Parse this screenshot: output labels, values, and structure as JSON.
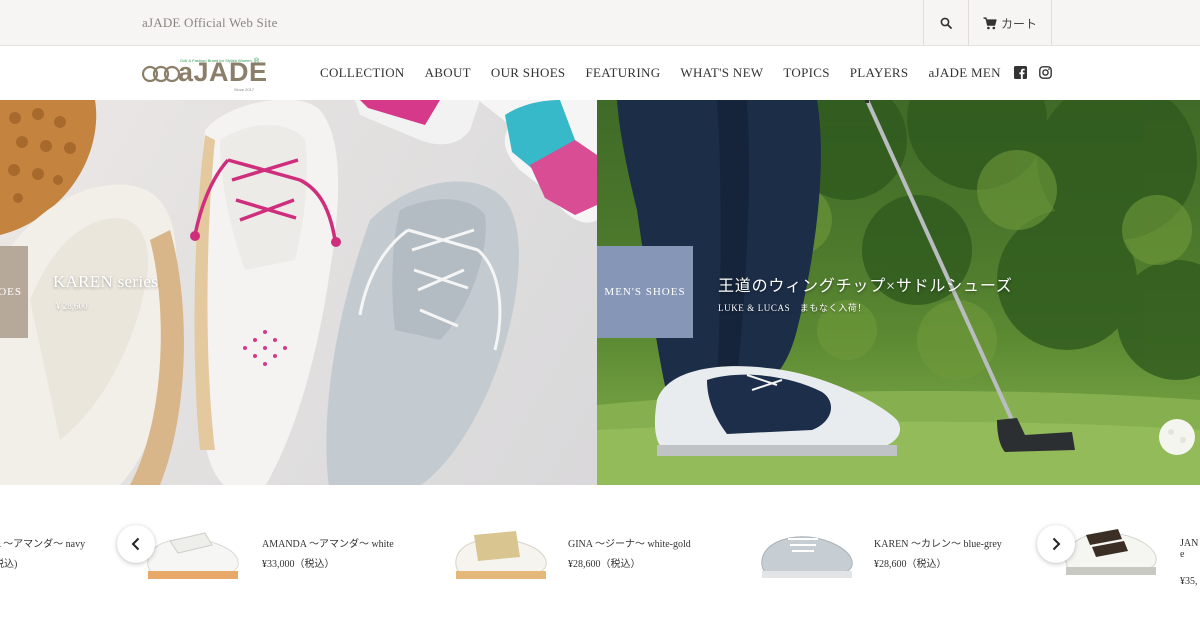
{
  "topbar": {
    "site_label": "aJADE Official Web Site",
    "cart_label": "カート"
  },
  "brand": {
    "logo_text": "aJADE",
    "registered_mark": "®",
    "tagline": "Golf & Fashion Brand for Stylish Women",
    "since": "Since 2017",
    "accent_color": "#8b7f6a",
    "green_color": "#2a9a4d"
  },
  "nav": {
    "items": [
      "COLLECTION",
      "ABOUT",
      "OUR SHOES",
      "FEATURING",
      "WHAT'S NEW",
      "TOPICS",
      "PLAYERS",
      "aJADE MEN"
    ]
  },
  "social": {
    "icons": [
      "facebook-icon",
      "instagram-icon"
    ]
  },
  "hero": {
    "left": {
      "category": "OES",
      "title": "KAREN series",
      "price": "¥ 28,600",
      "tag_color": "#b7a999"
    },
    "right": {
      "category": "MEN'S SHOES",
      "title": "王道のウィングチップ×サドルシューズ",
      "subtitle": "LUKE & LUCAS　まもなく入荷！",
      "tag_color": "#8596b6"
    }
  },
  "products": [
    {
      "name": "A ～アマンダ～ navy",
      "price": "税込)"
    },
    {
      "name": "AMANDA ～アマンダ～ white",
      "price": "¥33,000（税込）"
    },
    {
      "name": "GINA ～ジーナ～ white-gold",
      "price": "¥28,600（税込）"
    },
    {
      "name": "KAREN ～カレン～ blue-grey",
      "price": "¥28,600（税込）"
    },
    {
      "name": "JAN",
      "name2": "e",
      "price": "¥35,"
    }
  ]
}
